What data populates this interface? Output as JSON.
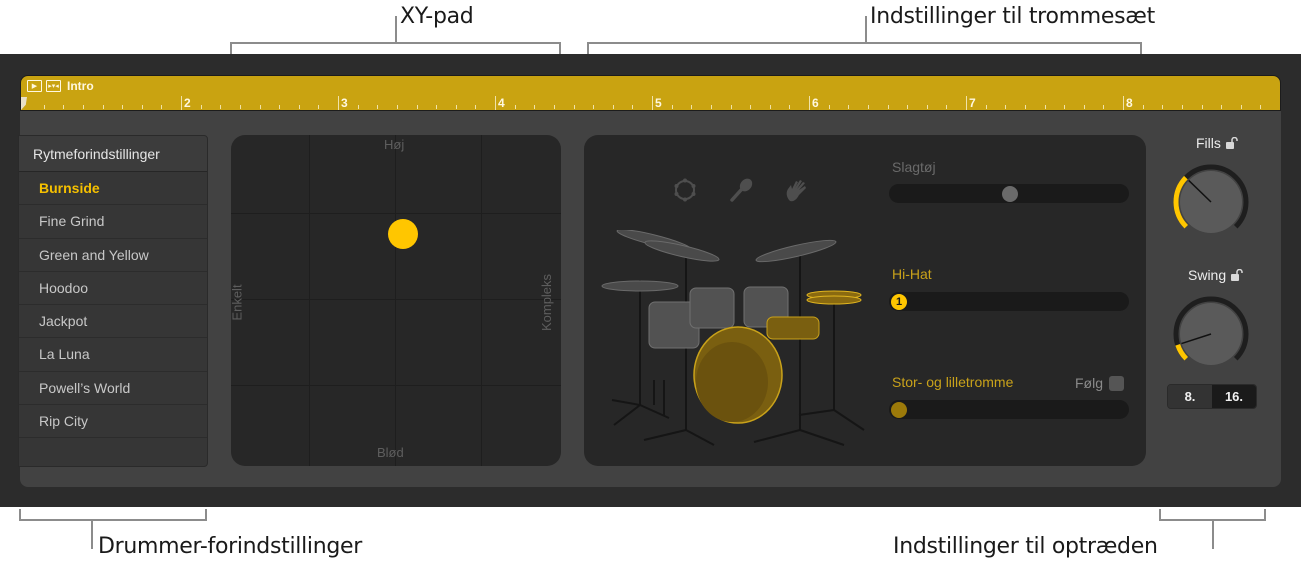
{
  "callouts": {
    "xy_pad": "XY-pad",
    "kit_settings": "Indstillinger til trommesæt",
    "drummer_presets": "Drummer-forindstillinger",
    "performance_settings": "Indstillinger til optræden"
  },
  "ruler": {
    "region_name": "Intro",
    "play_icon": "play-icon",
    "region_icon": "drummer-region-icon",
    "bars": [
      "2",
      "3",
      "4",
      "5",
      "6",
      "7",
      "8"
    ],
    "color": "#c9a311"
  },
  "presets": {
    "header": "Rytmeforindstillinger",
    "selected": "Burnside",
    "items": [
      "Burnside",
      "Fine Grind",
      "Green and Yellow",
      "Hoodoo",
      "Jackpot",
      "La Luna",
      "Powell’s World",
      "Rip City"
    ]
  },
  "xy_pad": {
    "top_label": "Høj",
    "bottom_label": "Blød",
    "left_label": "Enkelt",
    "right_label": "Kompleks",
    "puck_x": 0.52,
    "puck_y": 0.7,
    "puck_color": "#ffc600"
  },
  "kit": {
    "percussion_icons": [
      "tambourine-icon",
      "shaker-icon",
      "handclap-icon"
    ],
    "percussion": {
      "label": "Slagtøj",
      "value": 0.5
    },
    "hihat": {
      "label": "Hi-Hat",
      "value": 0.0,
      "knob_badge": "1"
    },
    "kick_snare": {
      "label": "Stor- og lilletromme",
      "value": 0.0,
      "follow_label": "Følg",
      "follow_checked": false
    }
  },
  "performance": {
    "fills": {
      "label": "Fills",
      "value": 0.33
    },
    "swing": {
      "label": "Swing",
      "value": 0.1
    },
    "swing_resolution": {
      "options": [
        "8.",
        "16."
      ],
      "selected": "16."
    }
  },
  "colors": {
    "accent": "#ffc600",
    "accent_dim": "#c9a21a",
    "background": "#2c2c2c",
    "panel": "#424242"
  }
}
